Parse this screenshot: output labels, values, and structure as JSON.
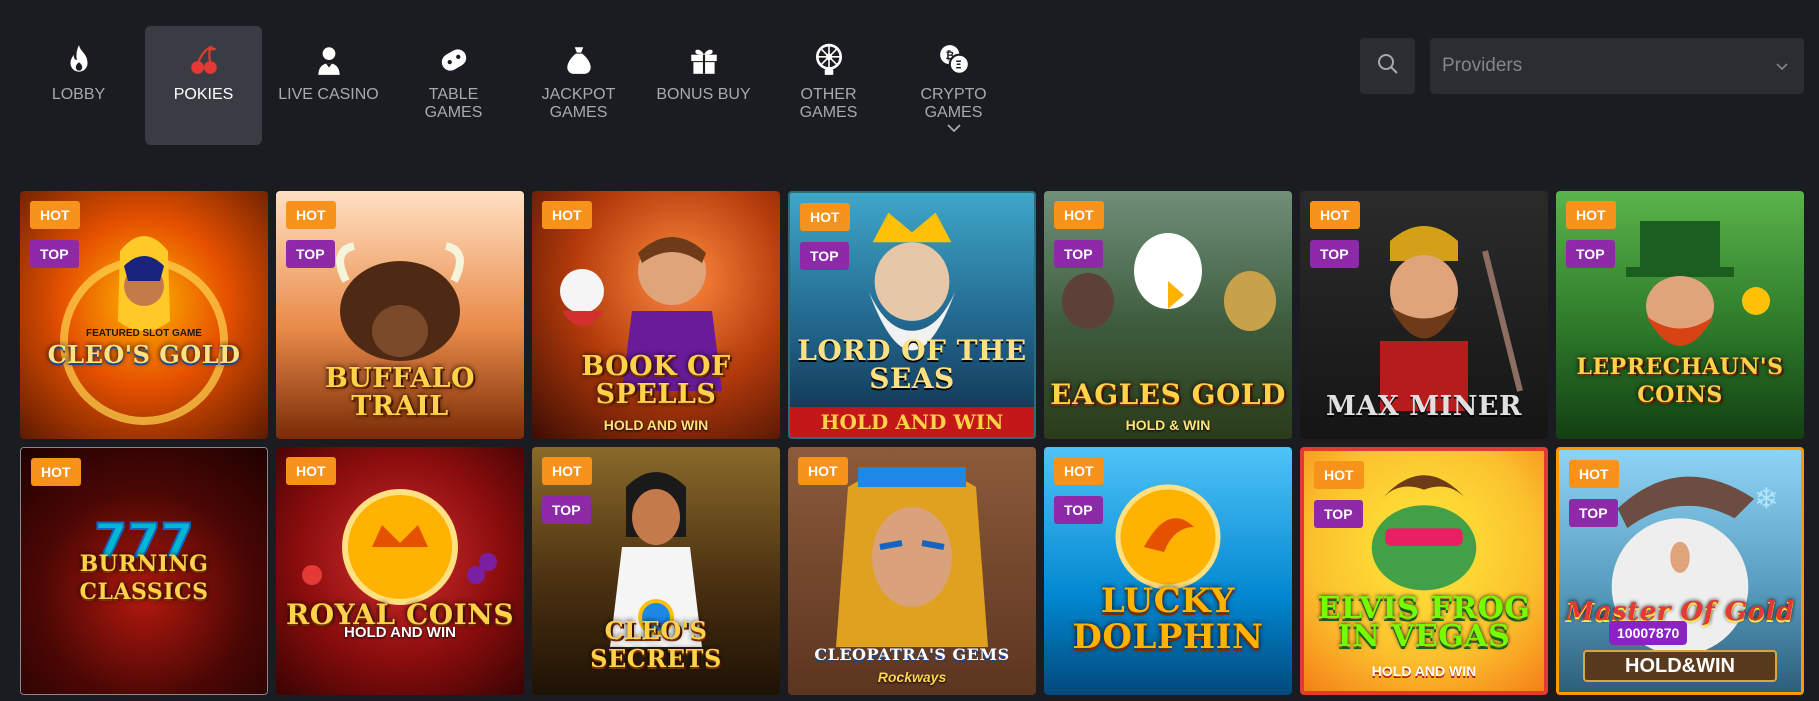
{
  "nav": {
    "items": [
      {
        "label": "LOBBY",
        "icon": "flame-icon",
        "active": false
      },
      {
        "label": "POKIES",
        "icon": "cherries-icon",
        "active": true
      },
      {
        "label": "LIVE CASINO",
        "icon": "dealer-icon",
        "active": false
      },
      {
        "label": "TABLE GAMES",
        "icon": "gamepad-icon",
        "active": false
      },
      {
        "label": "JACKPOT GAMES",
        "icon": "money-bag-icon",
        "active": false
      },
      {
        "label": "BONUS BUY",
        "icon": "gift-icon",
        "active": false
      },
      {
        "label": "OTHER GAMES",
        "icon": "roulette-icon",
        "active": false
      },
      {
        "label": "CRYPTO GAMES",
        "icon": "crypto-coins-icon",
        "active": false,
        "has_dropdown": true
      }
    ]
  },
  "search": {
    "icon": "search-icon"
  },
  "providers": {
    "placeholder": "Providers",
    "icon": "chevron-down-icon"
  },
  "badges": {
    "hot": "HOT",
    "top": "TOP"
  },
  "games": [
    {
      "title": "CLEO'S GOLD",
      "subtitle": "FEATURED SLOT GAME",
      "hot": true,
      "top": true
    },
    {
      "title": "BUFFALO TRAIL",
      "hot": true,
      "top": true
    },
    {
      "title": "BOOK OF SPELLS",
      "subtitle": "HOLD AND WIN",
      "hot": true,
      "top": false
    },
    {
      "title": "LORD OF THE SEAS",
      "subtitle": "HOLD AND WIN",
      "hot": true,
      "top": true
    },
    {
      "title": "EAGLES GOLD",
      "subtitle": "HOLD & WIN",
      "hot": true,
      "top": true
    },
    {
      "title": "MAX MINER",
      "hot": true,
      "top": true
    },
    {
      "title": "LEPRECHAUN'S COINS",
      "hot": true,
      "top": true
    },
    {
      "title": "BURNING CLASSICS",
      "hot": true,
      "top": false
    },
    {
      "title": "ROYAL COINS",
      "subtitle": "HOLD AND WIN",
      "hot": true,
      "top": false
    },
    {
      "title": "CLEO'S SECRETS",
      "hot": true,
      "top": true
    },
    {
      "title": "CLEOPATRA'S GEMS",
      "subtitle": "Rockways",
      "hot": true,
      "top": false
    },
    {
      "title": "LUCKY DOLPHIN",
      "hot": true,
      "top": true
    },
    {
      "title": "ELVIS FROG IN VEGAS",
      "subtitle": "HOLD AND WIN",
      "hot": true,
      "top": true
    },
    {
      "title": "Master Of Gold",
      "subtitle": "HOLD&WIN",
      "jackpot": "10007870",
      "hot": true,
      "top": true
    }
  ],
  "colors": {
    "background": "#1b1c21",
    "nav_active": "#3a3c44",
    "hot_badge": "#f7931a",
    "top_badge": "#8e2aa8",
    "input_bg": "#2b2d33"
  }
}
